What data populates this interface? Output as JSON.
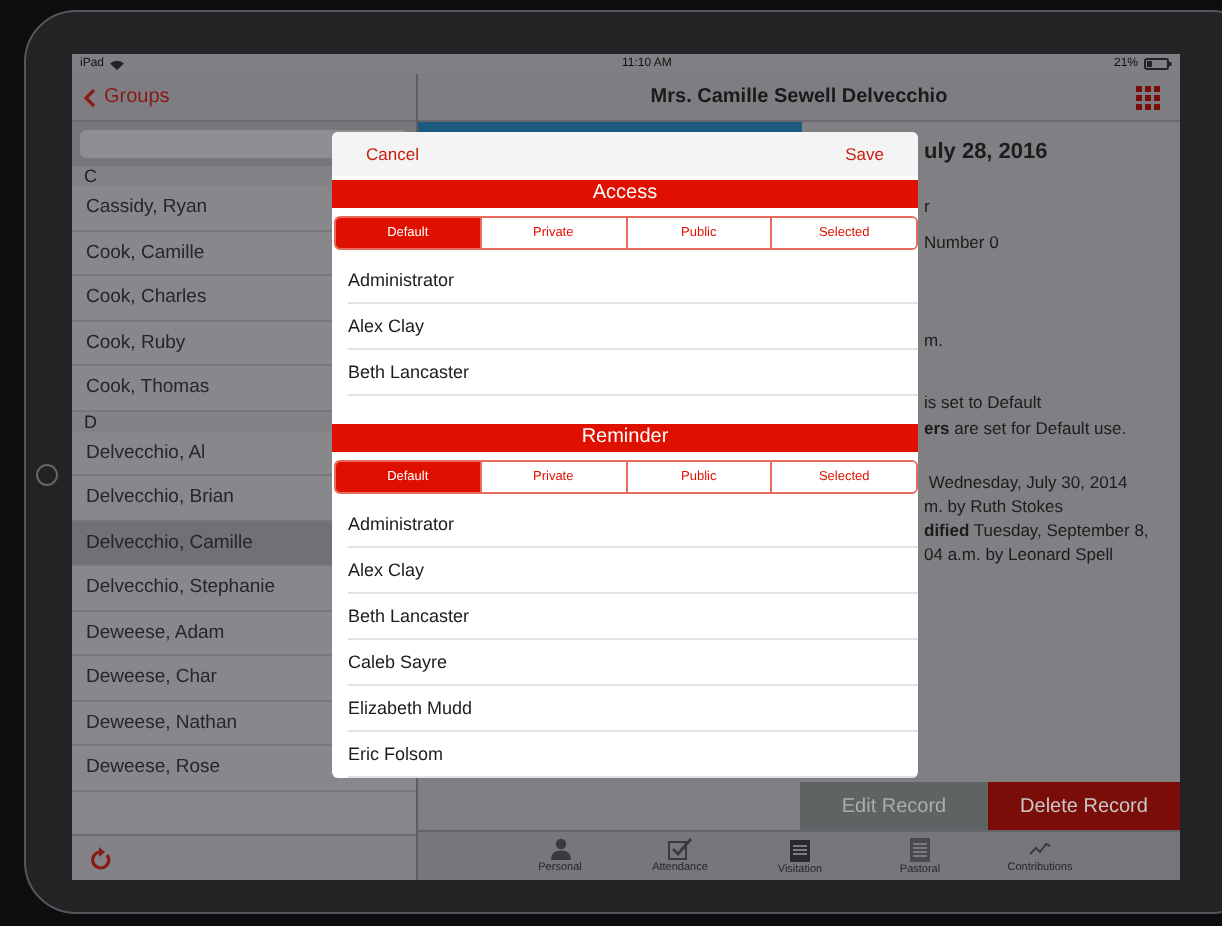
{
  "status_bar": {
    "device": "iPad",
    "time": "11:10 AM",
    "battery": "21%"
  },
  "sidebar": {
    "back": "Groups",
    "sections": [
      {
        "header": "C",
        "items": [
          {
            "name": "Cassidy, Ryan",
            "selected": false
          },
          {
            "name": "Cook, Camille",
            "selected": false
          },
          {
            "name": "Cook, Charles",
            "selected": false
          },
          {
            "name": "Cook, Ruby",
            "selected": false
          },
          {
            "name": "Cook, Thomas",
            "selected": false
          }
        ]
      },
      {
        "header": "D",
        "items": [
          {
            "name": "Delvecchio, Al",
            "selected": false
          },
          {
            "name": "Delvecchio, Brian",
            "selected": false
          },
          {
            "name": "Delvecchio, Camille",
            "selected": true
          },
          {
            "name": "Delvecchio, Stephanie",
            "selected": false
          },
          {
            "name": "Deweese, Adam",
            "selected": false
          },
          {
            "name": "Deweese, Char",
            "selected": false
          },
          {
            "name": "Deweese, Nathan",
            "selected": false
          },
          {
            "name": "Deweese, Rose",
            "selected": false
          }
        ]
      }
    ]
  },
  "detail": {
    "title": "Mrs. Camille Sewell Delvecchio",
    "lines": [
      "**uly 28, 2016**",
      "r",
      "Number 0",
      "m.",
      "is set to Default",
      "**ers** are set for Default use.",
      " Wednesday, July 30, 2014",
      "m. by Ruth Stokes",
      "**dified** Tuesday, September 8,",
      "04 a.m. by Leonard Spell"
    ],
    "buttons": [
      {
        "label": "Edit Record",
        "kind": "secondary"
      },
      {
        "label": "Delete Record",
        "kind": "danger"
      }
    ]
  },
  "tab_bar": [
    {
      "label": "Personal",
      "kind": "person"
    },
    {
      "label": "Attendance",
      "kind": "check"
    },
    {
      "label": "Visitation",
      "kind": "notebook"
    },
    {
      "label": "Pastoral",
      "kind": "pad"
    },
    {
      "label": "Contributions",
      "kind": "chart"
    }
  ],
  "dialog": {
    "cancel": "Cancel",
    "save": "Save",
    "sections": [
      {
        "title": "Access",
        "options": [
          {
            "label": "Default",
            "selected": true
          },
          {
            "label": "Private",
            "selected": false
          },
          {
            "label": "Public",
            "selected": false
          },
          {
            "label": "Selected",
            "selected": false
          }
        ],
        "people": [
          "Administrator",
          "Alex Clay",
          "Beth Lancaster"
        ]
      },
      {
        "title": "Reminder",
        "options": [
          {
            "label": "Default",
            "selected": true
          },
          {
            "label": "Private",
            "selected": false
          },
          {
            "label": "Public",
            "selected": false
          },
          {
            "label": "Selected",
            "selected": false
          }
        ],
        "people": [
          "Administrator",
          "Alex Clay",
          "Beth Lancaster",
          "Caleb Sayre",
          "Elizabeth Mudd",
          "Eric Folsom"
        ]
      }
    ]
  }
}
